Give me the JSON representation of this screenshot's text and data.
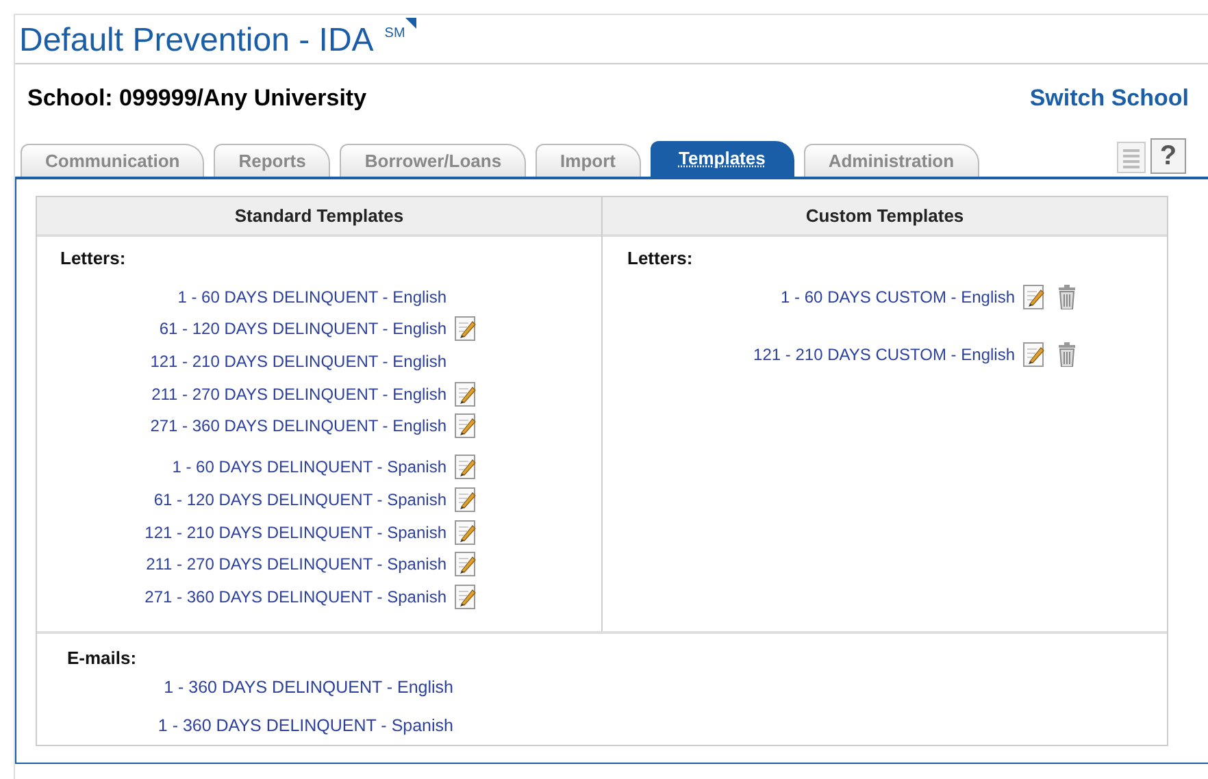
{
  "app": {
    "title": "Default Prevention - IDA",
    "mark": "SM"
  },
  "school": {
    "label": "School: 099999/Any University",
    "switch_link": "Switch School"
  },
  "tabs": [
    {
      "label": "Communication",
      "selected": false
    },
    {
      "label": "Reports",
      "selected": false
    },
    {
      "label": "Borrower/Loans",
      "selected": false
    },
    {
      "label": "Import",
      "selected": false
    },
    {
      "label": "Templates",
      "selected": true
    },
    {
      "label": "Administration",
      "selected": false
    }
  ],
  "help_button": "?",
  "standard": {
    "heading": "Standard Templates",
    "section": "Letters:",
    "groups": [
      [
        {
          "label": "1 - 60 DAYS DELINQUENT - English",
          "editable": false
        },
        {
          "label": "61 - 120 DAYS DELINQUENT - English",
          "editable": true
        },
        {
          "label": "121 - 210 DAYS DELINQUENT - English",
          "editable": false
        },
        {
          "label": "211 - 270 DAYS DELINQUENT - English",
          "editable": true
        },
        {
          "label": "271 - 360 DAYS DELINQUENT - English",
          "editable": true
        }
      ],
      [
        {
          "label": "1 - 60 DAYS DELINQUENT - Spanish",
          "editable": true
        },
        {
          "label": "61 - 120 DAYS DELINQUENT - Spanish",
          "editable": true
        },
        {
          "label": "121 - 210 DAYS DELINQUENT - Spanish",
          "editable": true
        },
        {
          "label": "211 - 270 DAYS DELINQUENT - Spanish",
          "editable": true
        },
        {
          "label": "271 - 360 DAYS DELINQUENT - Spanish",
          "editable": true
        }
      ]
    ]
  },
  "custom": {
    "heading": "Custom Templates",
    "section": "Letters:",
    "items": [
      {
        "label": "1 - 60 DAYS CUSTOM - English",
        "editable": true,
        "deletable": true
      },
      {
        "label": "121 - 210 DAYS CUSTOM - English",
        "editable": true,
        "deletable": true
      }
    ]
  },
  "emails": {
    "section": "E-mails:",
    "items": [
      {
        "label": "1 - 360 DAYS DELINQUENT - English"
      },
      {
        "label": "1 - 360 DAYS DELINQUENT - Spanish"
      }
    ]
  }
}
